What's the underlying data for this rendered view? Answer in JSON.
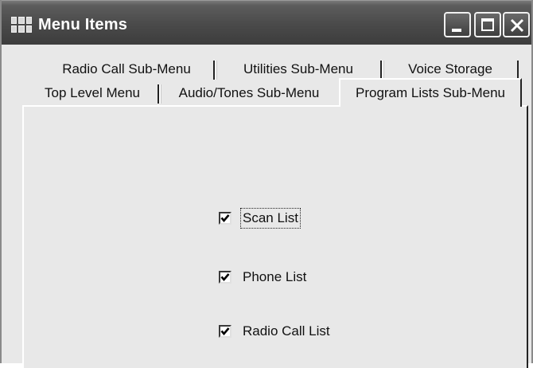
{
  "window": {
    "title": "Menu Items"
  },
  "tabs": {
    "back_row": [
      "Radio Call Sub-Menu",
      "Utilities Sub-Menu",
      "Voice Storage"
    ],
    "front_row": [
      "Top Level Menu",
      "Audio/Tones Sub-Menu",
      "Program Lists Sub-Menu"
    ],
    "active": "Program Lists Sub-Menu"
  },
  "checkboxes": [
    {
      "label": "Scan List",
      "checked": true,
      "focused": true
    },
    {
      "label": "Phone List",
      "checked": true,
      "focused": false
    },
    {
      "label": "Radio Call List",
      "checked": true,
      "focused": false
    }
  ]
}
